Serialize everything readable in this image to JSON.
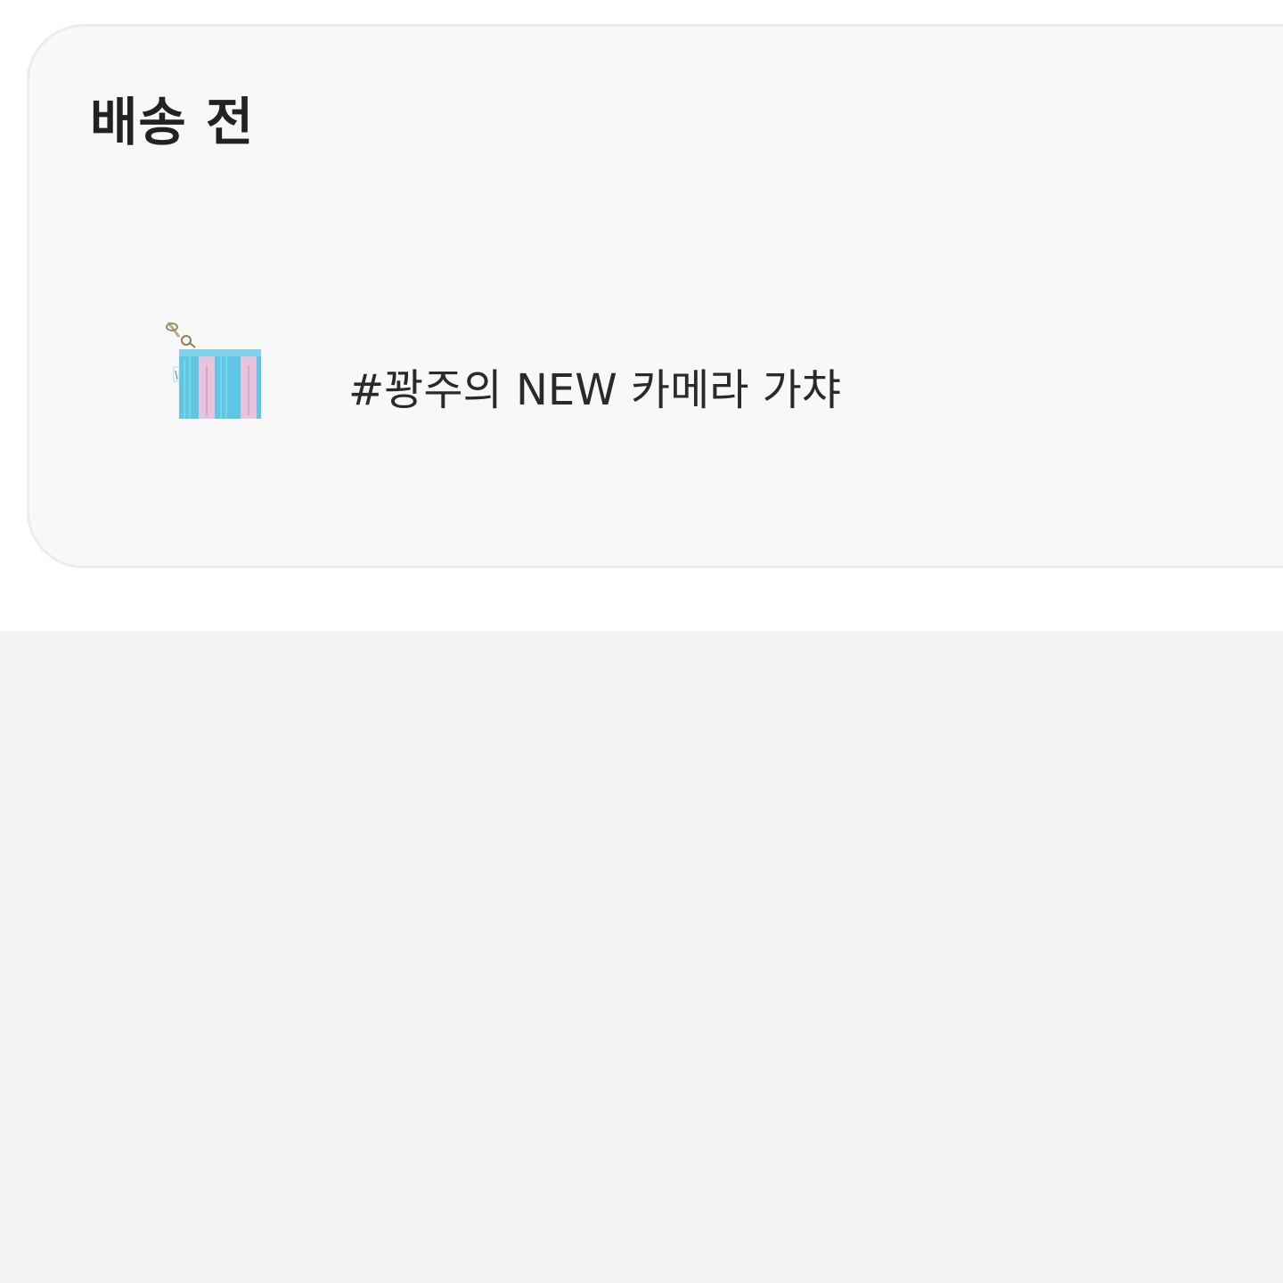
{
  "section": {
    "title": "배송 전"
  },
  "items": [
    {
      "name": "#꽝주의 NEW 카메라 가챠",
      "thumbnail": "striped-pouch-keychain-image",
      "thumbnail_colors": {
        "stripe_a": "#5fc6e3",
        "stripe_b": "#e9c3dd",
        "clasp": "#b9a98a"
      }
    }
  ],
  "colors": {
    "card_background": "#f8f8f8",
    "card_border": "#ececec",
    "page_bottom": "#f4f4f4",
    "title_text": "#222222",
    "item_text": "#2a2a2a"
  }
}
